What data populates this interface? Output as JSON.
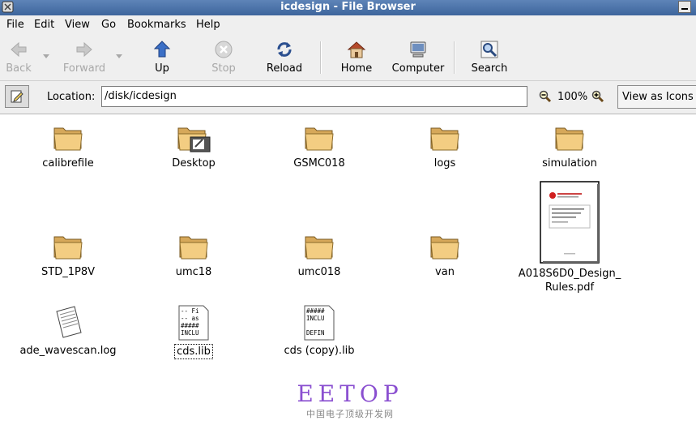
{
  "window": {
    "title": "icdesign - File Browser"
  },
  "menu": [
    "File",
    "Edit",
    "View",
    "Go",
    "Bookmarks",
    "Help"
  ],
  "toolbar": {
    "back": "Back",
    "forward": "Forward",
    "up": "Up",
    "stop": "Stop",
    "reload": "Reload",
    "home": "Home",
    "computer": "Computer",
    "search": "Search"
  },
  "location": {
    "label": "Location:",
    "value": "/disk/icdesign",
    "zoom": "100%",
    "view_as": "View as Icons"
  },
  "files": [
    {
      "name": "calibrefile",
      "kind": "folder"
    },
    {
      "name": "Desktop",
      "kind": "folder-desktop"
    },
    {
      "name": "GSMC018",
      "kind": "folder"
    },
    {
      "name": "logs",
      "kind": "folder"
    },
    {
      "name": "simulation",
      "kind": "folder"
    },
    {
      "name": "STD_1P8V",
      "kind": "folder"
    },
    {
      "name": "umc18",
      "kind": "folder"
    },
    {
      "name": "umc018",
      "kind": "folder"
    },
    {
      "name": "van",
      "kind": "folder"
    },
    {
      "name": "A018S6D0_Design_Rules.pdf",
      "line1": "A018S6D0_Design_",
      "line2": "Rules.pdf",
      "kind": "pdf"
    },
    {
      "name": "ade_wavescan.log",
      "kind": "text"
    },
    {
      "name": "cds.lib",
      "kind": "text-preview",
      "preview": [
        "-- Fi",
        "-- as",
        "#####",
        "INCLU"
      ],
      "selected": true
    },
    {
      "name": "cds (copy).lib",
      "kind": "text-preview",
      "preview": [
        "#####",
        "INCLU",
        "",
        "DEFIN"
      ]
    }
  ],
  "watermark": {
    "title": "EETOP",
    "subtitle": "中国电子顶级开发网"
  }
}
